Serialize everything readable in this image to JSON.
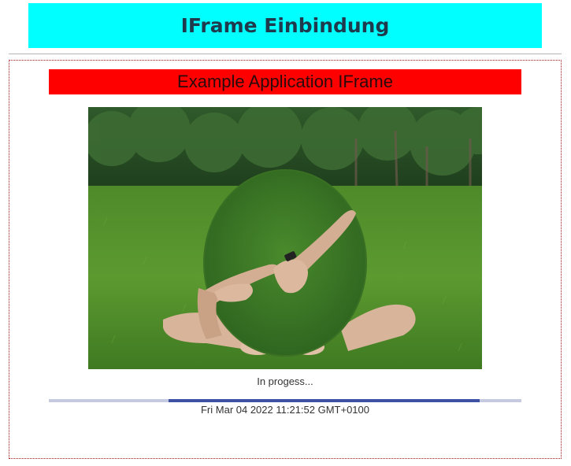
{
  "header": {
    "title": "IFrame Einbindung",
    "background": "#00ffff"
  },
  "iframe": {
    "title": "Example Application IFrame",
    "title_background": "#ff0000",
    "image_icon": "photo-hand-in-mirror-on-grass",
    "status": "In progess...",
    "progress": {
      "start_fraction": 0.253,
      "end_fraction": 0.912,
      "track_color": "#c5cae0",
      "fill_color": "#3f51a5"
    },
    "timestamp": "Fri Mar 04 2022 11:21:52 GMT+0100"
  }
}
